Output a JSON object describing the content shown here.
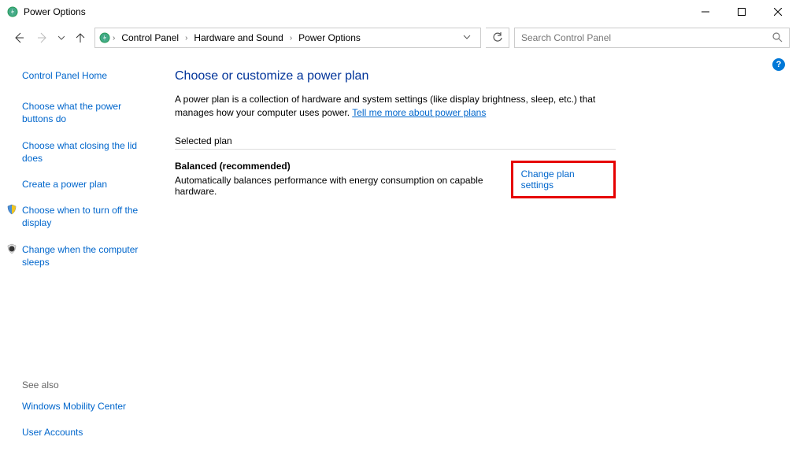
{
  "window": {
    "title": "Power Options"
  },
  "breadcrumbs": {
    "item0": "Control Panel",
    "item1": "Hardware and Sound",
    "item2": "Power Options"
  },
  "search": {
    "placeholder": "Search Control Panel"
  },
  "sidebar": {
    "link0": "Control Panel Home",
    "link1": "Choose what the power buttons do",
    "link2": "Choose what closing the lid does",
    "link3": "Create a power plan",
    "link4": "Choose when to turn off the display",
    "link5": "Change when the computer sleeps",
    "see_also_label": "See also",
    "see0": "Windows Mobility Center",
    "see1": "User Accounts"
  },
  "main": {
    "heading": "Choose or customize a power plan",
    "desc_part1": "A power plan is a collection of hardware and system settings (like display brightness, sleep, etc.) that manages how your computer uses power. ",
    "tell_more": "Tell me more about power plans",
    "section_label": "Selected plan",
    "plan_name": "Balanced (recommended)",
    "plan_desc": "Automatically balances performance with energy consumption on capable hardware.",
    "change_link": "Change plan settings"
  }
}
